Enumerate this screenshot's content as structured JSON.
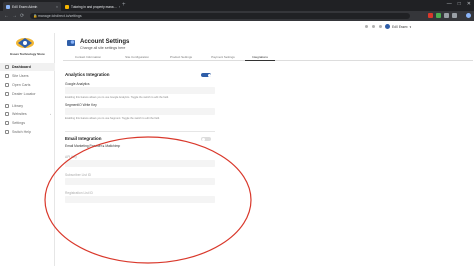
{
  "browser": {
    "tabs": [
      {
        "title": "EdX Essex Admin",
        "close": "×"
      },
      {
        "title": "Tutoring in and property mana…",
        "close": "×"
      }
    ],
    "new_tab": "+",
    "url": "manage.tchdirect.io/settings",
    "nav": {
      "back": "←",
      "forward": "→",
      "reload": "⟳"
    },
    "window_controls": [
      "—",
      "□",
      "✕"
    ]
  },
  "user": {
    "name": "EdX Essex"
  },
  "sidebar": {
    "logo_text": "Essex Technology Store",
    "items": [
      {
        "label": "Dashboard"
      },
      {
        "label": "Site Users"
      },
      {
        "label": "Open Carts"
      },
      {
        "label": "Dealer Locator"
      },
      {
        "label": "Library"
      },
      {
        "label": "Websites"
      },
      {
        "label": "Settings"
      },
      {
        "label": "Switch Help"
      }
    ]
  },
  "header": {
    "title": "Account Settings",
    "subtitle": "Change all site settings here"
  },
  "settings_tabs": [
    {
      "label": "Contact Information"
    },
    {
      "label": "Site Configuration"
    },
    {
      "label": "Product Settings"
    },
    {
      "label": "Payment Settings"
    },
    {
      "label": "Integrations"
    }
  ],
  "analytics": {
    "title": "Analytics Integration",
    "google_label": "Google Analytics",
    "google_help": "Enabling this feature allows you to use Google Analytics. Toggle the switch to edit the field.",
    "segment_label": "SegmentIO Write Key",
    "segment_help": "Enabling this feature allows you to use Segment. Toggle the switch to edit the field."
  },
  "email": {
    "title": "Email Integration",
    "provider_label": "Email Marketing Provider",
    "provider_value": "Mailchimp",
    "fields": [
      {
        "label": "API Key"
      },
      {
        "label": "Subscriber List ID"
      },
      {
        "label": "Registration List ID"
      }
    ]
  },
  "colors": {
    "accent": "#2f5ea8",
    "annotation": "#d9382b"
  }
}
